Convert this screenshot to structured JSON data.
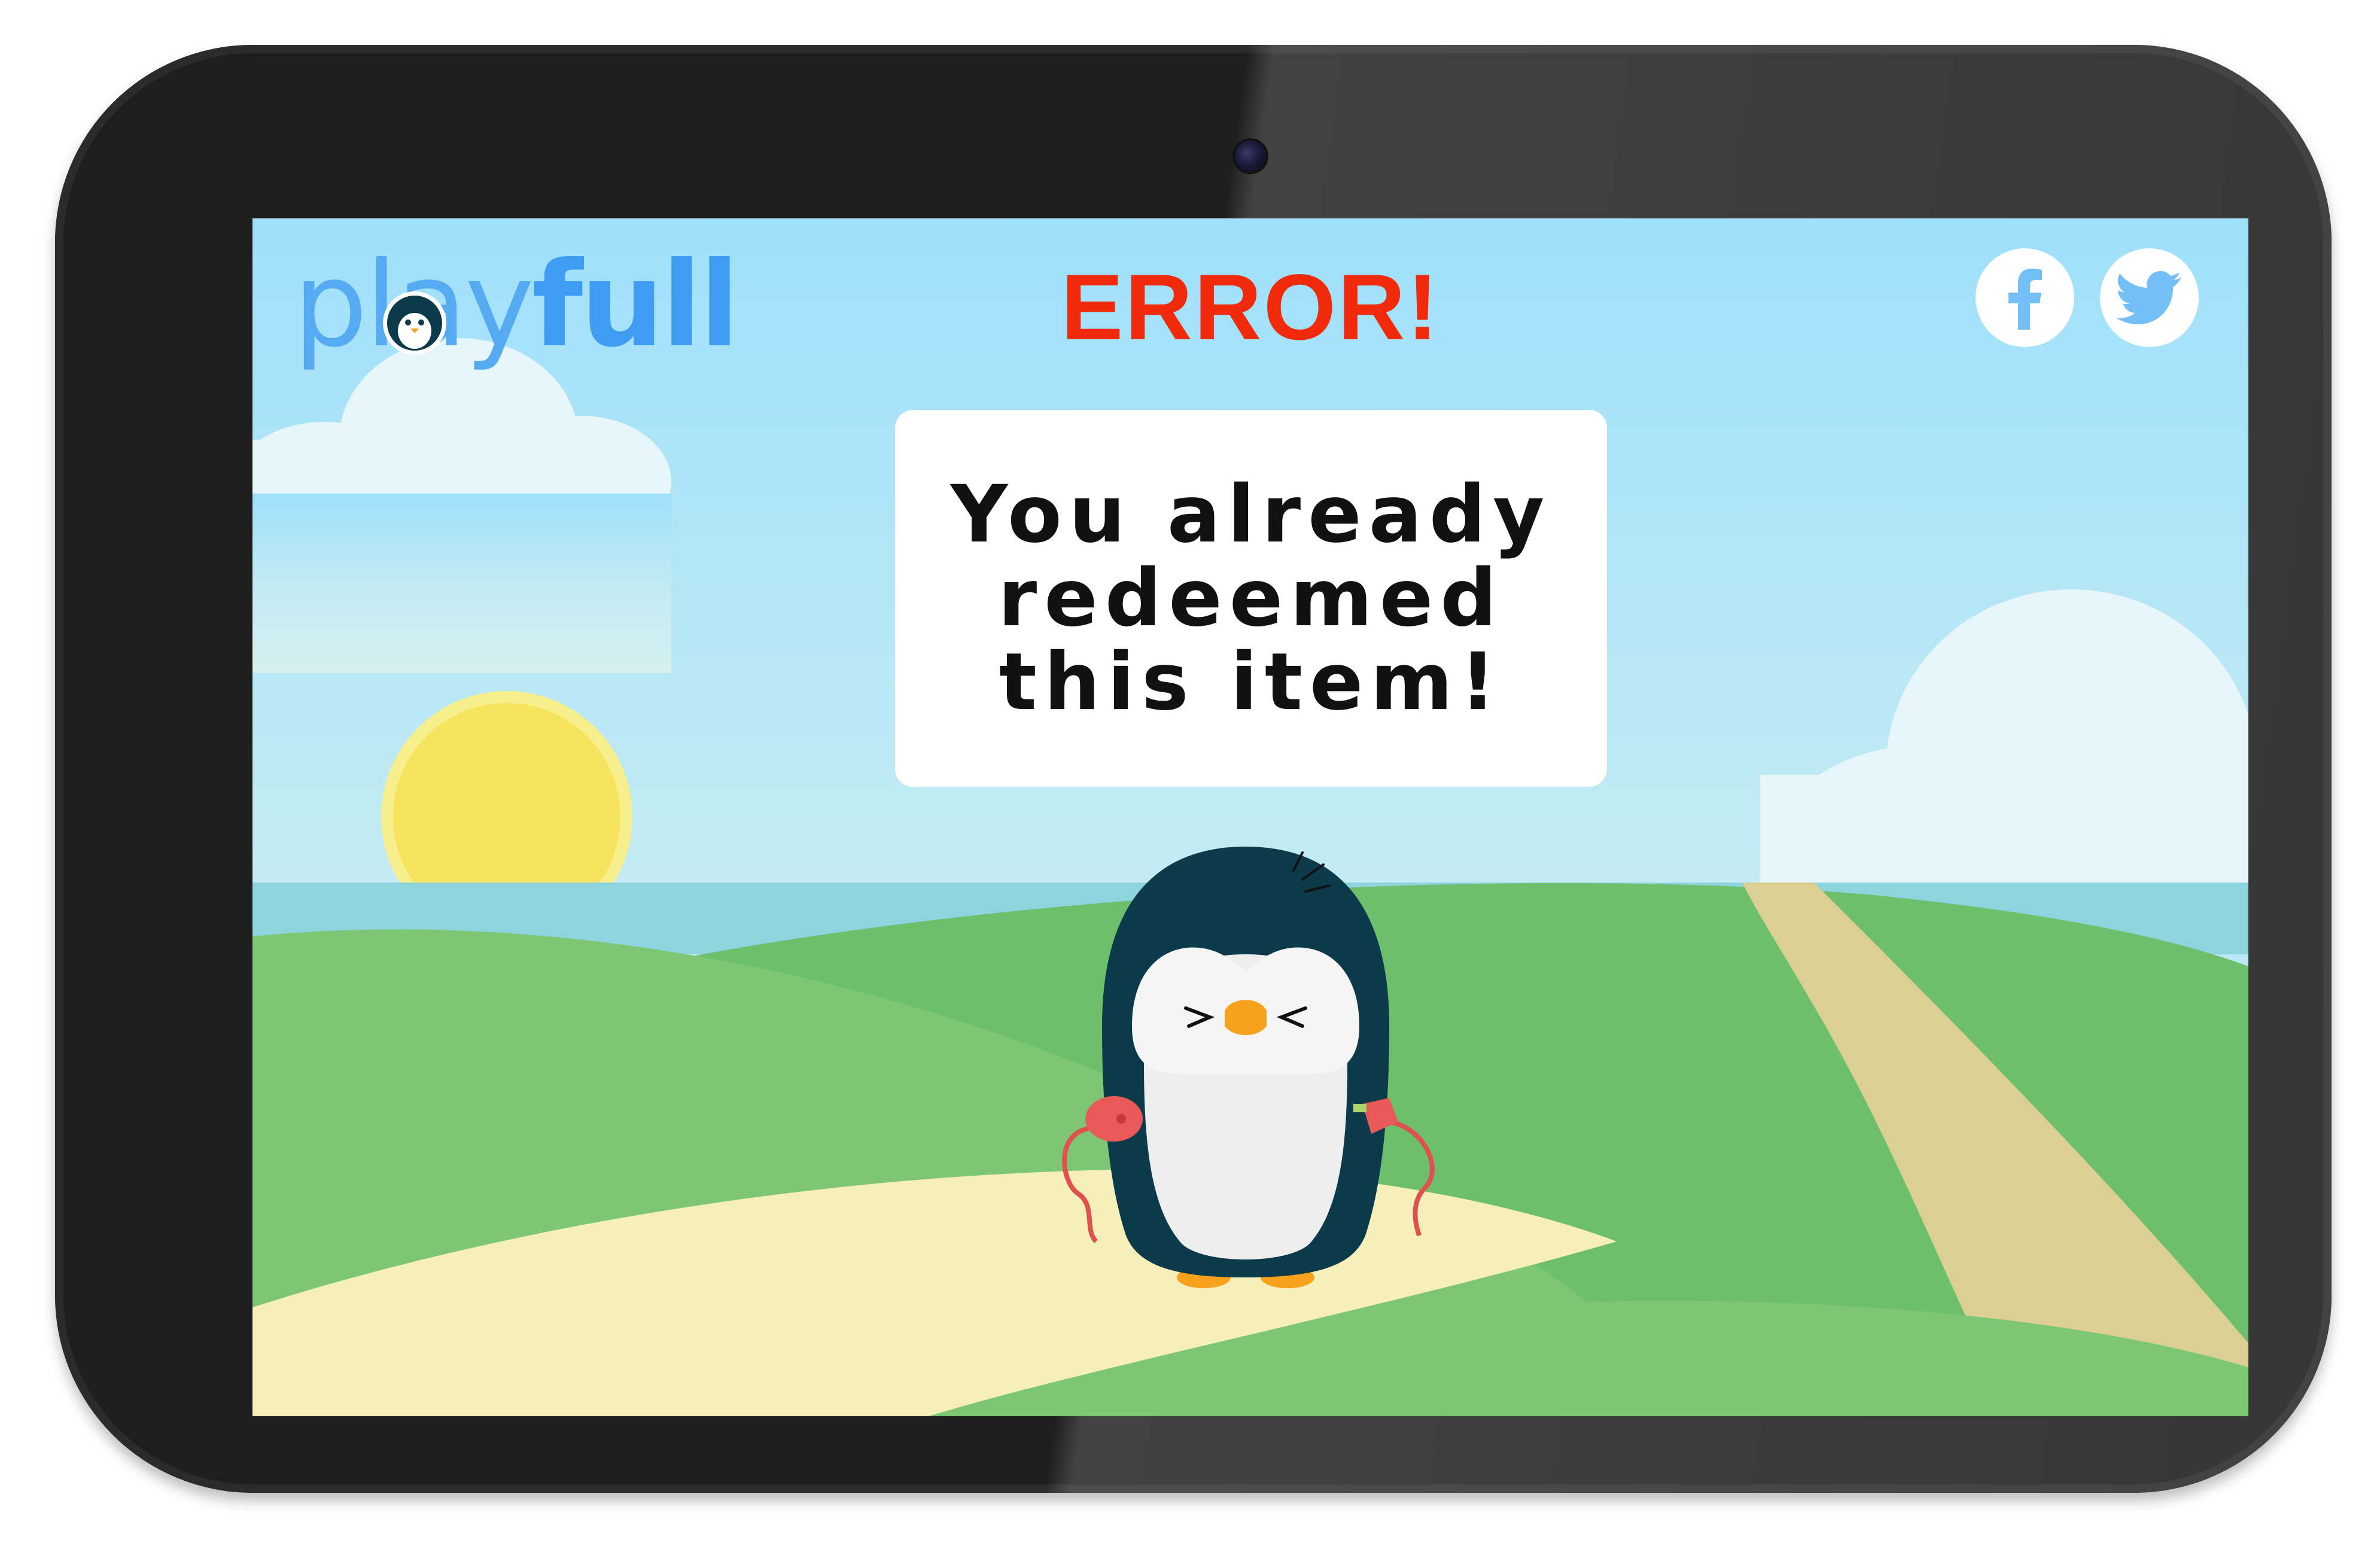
{
  "app": {
    "logo_light": "play",
    "logo_bold": "full"
  },
  "header": {
    "title": "ERROR!",
    "title_color": "#f02a0a"
  },
  "social": [
    {
      "name": "facebook",
      "icon": "facebook-icon"
    },
    {
      "name": "twitter",
      "icon": "twitter-icon"
    }
  ],
  "dialog": {
    "message": "You already redeemed this item!"
  },
  "colors": {
    "sky_top": "#9fe0f8",
    "sky_bottom": "#d9f1f2",
    "grass": "#7dc673",
    "path": "#f6efba",
    "sun": "#f7e45e",
    "brand_blue": "#3f9cf2"
  }
}
